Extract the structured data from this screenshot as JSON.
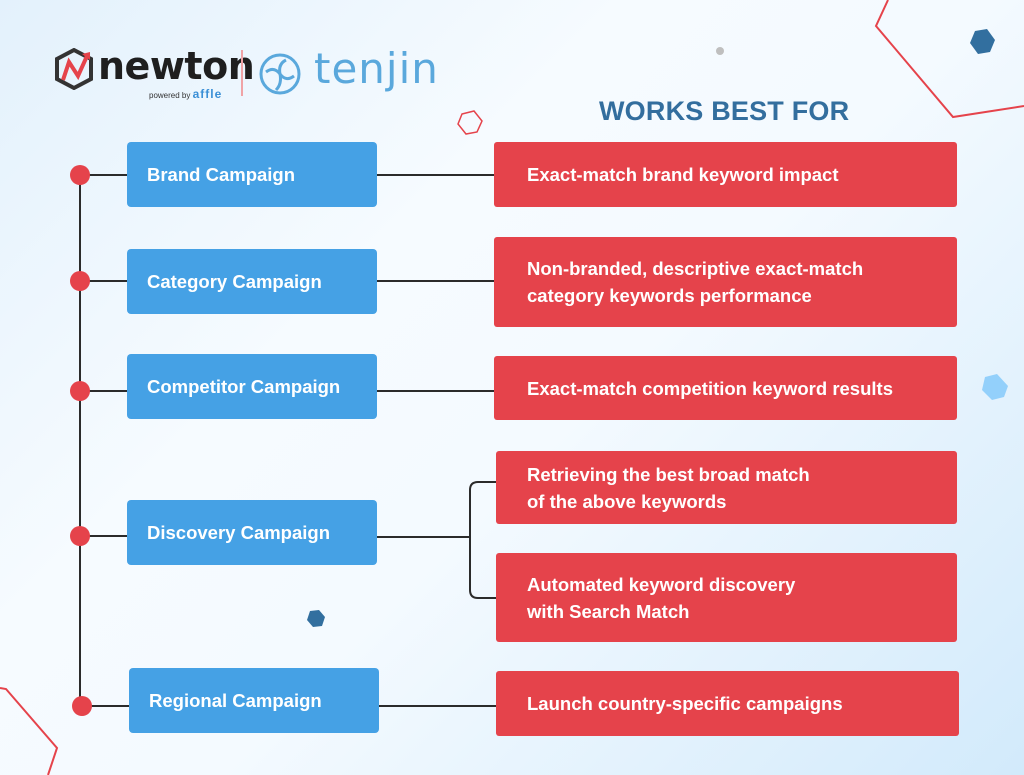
{
  "branding": {
    "newton_name": "newton",
    "newton_tagline": "powered by",
    "newton_parent": "affle",
    "partner_name": "tenjin"
  },
  "heading": "WORKS BEST FOR",
  "colors": {
    "campaign_box": "#45a1e5",
    "use_case_box": "#e5434b",
    "heading": "#336e9e",
    "connector": "#2b2b2b",
    "node_dot": "#e5434b"
  },
  "campaigns": [
    {
      "label": "Brand Campaign",
      "works_best_for": [
        "Exact-match brand keyword impact"
      ]
    },
    {
      "label": "Category Campaign",
      "works_best_for": [
        "Non-branded, descriptive exact-match\ncategory keywords performance"
      ]
    },
    {
      "label": "Competitor Campaign",
      "works_best_for": [
        "Exact-match competition keyword results"
      ]
    },
    {
      "label": "Discovery Campaign",
      "works_best_for": [
        "Retrieving the best broad match\nof the above keywords",
        "Automated keyword discovery\nwith Search Match"
      ]
    },
    {
      "label": "Regional Campaign",
      "works_best_for": [
        "Launch country-specific campaigns"
      ]
    }
  ]
}
